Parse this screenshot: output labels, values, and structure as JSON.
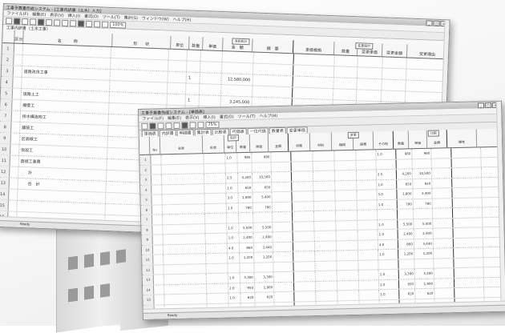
{
  "scene": {
    "accent": "#8e8e8e"
  },
  "window1": {
    "title": "工事予算書作成システム - [工事内訳書（土木）入力]",
    "menus": [
      "ファイル(F)",
      "編集(E)",
      "表示(V)",
      "挿入(I)",
      "書式(O)",
      "ツール(T)",
      "集計(S)",
      "ウィンドウ(W)",
      "ヘルプ(H)"
    ],
    "zoom": "100%",
    "sheet_name": "工事内訳書（土木工事）",
    "group_main": "当初設計",
    "group_change": "変更設計",
    "headers": [
      "区分",
      "名　　　称",
      "形　　状",
      "単位",
      "数量",
      "単価",
      "金　額",
      "摘　要",
      "単価根拠",
      "数量",
      "変更単価",
      "変更金額",
      "変更理由"
    ],
    "rows": [
      {
        "n": "1",
        "name": "",
        "qty": "",
        "price": "",
        "amount": ""
      },
      {
        "n": "2",
        "name": "",
        "qty": "",
        "price": "",
        "amount": ""
      },
      {
        "n": "3",
        "name": "道路改良工事",
        "qty": "1",
        "price": "",
        "amount": "12,580,000"
      },
      {
        "n": "4",
        "name": "",
        "qty": "",
        "price": "",
        "amount": ""
      },
      {
        "n": "5",
        "name": "道路土工",
        "qty": "1",
        "price": "",
        "amount": "3,245,000"
      },
      {
        "n": "6",
        "name": "擁壁工",
        "qty": "1",
        "price": "",
        "amount": "4,120,000"
      },
      {
        "n": "7",
        "name": "排水構造物工",
        "qty": "1",
        "price": "",
        "amount": "2,380,000"
      },
      {
        "n": "8",
        "name": "舗装工",
        "qty": "1",
        "price": "",
        "amount": "1,965,000"
      },
      {
        "n": "9",
        "name": "区画線工",
        "qty": "1",
        "price": "",
        "amount": "870,000"
      },
      {
        "n": "10",
        "name": "仮設工",
        "qty": "",
        "price": "",
        "amount": ""
      },
      {
        "n": "11",
        "name": "直接工事費",
        "qty": "",
        "price": "",
        "amount": ""
      },
      {
        "n": "12",
        "name": "　　計",
        "qty": "",
        "price": "",
        "amount": ""
      },
      {
        "n": "13",
        "name": "　　合　計",
        "qty": "",
        "price": "",
        "amount": ""
      },
      {
        "n": "14",
        "name": "",
        "qty": "",
        "price": "",
        "amount": ""
      },
      {
        "n": "15",
        "name": "",
        "qty": "",
        "price": "",
        "amount": ""
      },
      {
        "n": "16",
        "name": "",
        "qty": "",
        "price": "",
        "amount": ""
      }
    ],
    "status": "Ready"
  },
  "window2": {
    "title": "工事予算書作成システム - [単価表]",
    "menus": [
      "ファイル(F)",
      "編集(E)",
      "表示(V)",
      "挿入(I)",
      "書式(O)",
      "ツール(T)",
      "ヘルプ(H)"
    ],
    "zoom": "75%",
    "tabs": [
      "単価表",
      "内訳書",
      "明細書",
      "集計表",
      "比較表",
      "代価表",
      "一位代価",
      "数量表",
      "変更単価"
    ],
    "headers": [
      "No",
      "名称",
      "形状",
      "単位",
      "数量",
      "単価",
      "金額",
      "労務",
      "材料",
      "機械",
      "経費",
      "その他",
      "数量",
      "単価",
      "金額",
      "備考"
    ],
    "groups": [
      "当初",
      "変更",
      "比較"
    ],
    "rows": [
      {
        "n": "1",
        "q": "1.0",
        "p": "980",
        "a": "980"
      },
      {
        "n": "2",
        "q": "",
        "p": "",
        "a": ""
      },
      {
        "n": "3",
        "q": "2.5",
        "p": "4,200",
        "a": "10,500"
      },
      {
        "n": "4",
        "q": "1.0",
        "p": "650",
        "a": "650"
      },
      {
        "n": "5",
        "q": "3.0",
        "p": "1,800",
        "a": "5,400"
      },
      {
        "n": "6",
        "q": "1.0",
        "p": "780",
        "a": "780"
      },
      {
        "n": "7",
        "q": "",
        "p": "",
        "a": ""
      },
      {
        "n": "8",
        "q": "1.0",
        "p": "5,500",
        "a": "5,500"
      },
      {
        "n": "9",
        "q": "1.0",
        "p": "2,400",
        "a": "2,400"
      },
      {
        "n": "10",
        "q": "4.0",
        "p": "860",
        "a": "3,440"
      },
      {
        "n": "11",
        "q": "1.0",
        "p": "1,200",
        "a": "1,200"
      },
      {
        "n": "12",
        "q": "",
        "p": "",
        "a": ""
      },
      {
        "n": "13",
        "q": "1.0",
        "p": "3,300",
        "a": "3,300"
      },
      {
        "n": "14",
        "q": "2.0",
        "p": "950",
        "a": "1,900"
      },
      {
        "n": "15",
        "q": "1.0",
        "p": "620",
        "a": "620"
      },
      {
        "n": "16",
        "q": "",
        "p": "",
        "a": ""
      },
      {
        "n": "17",
        "q": "1.0",
        "p": "7,800",
        "a": "7,800"
      },
      {
        "n": "18",
        "q": "1.0",
        "p": "1,450",
        "a": "1,450"
      }
    ],
    "status": "Ready"
  }
}
